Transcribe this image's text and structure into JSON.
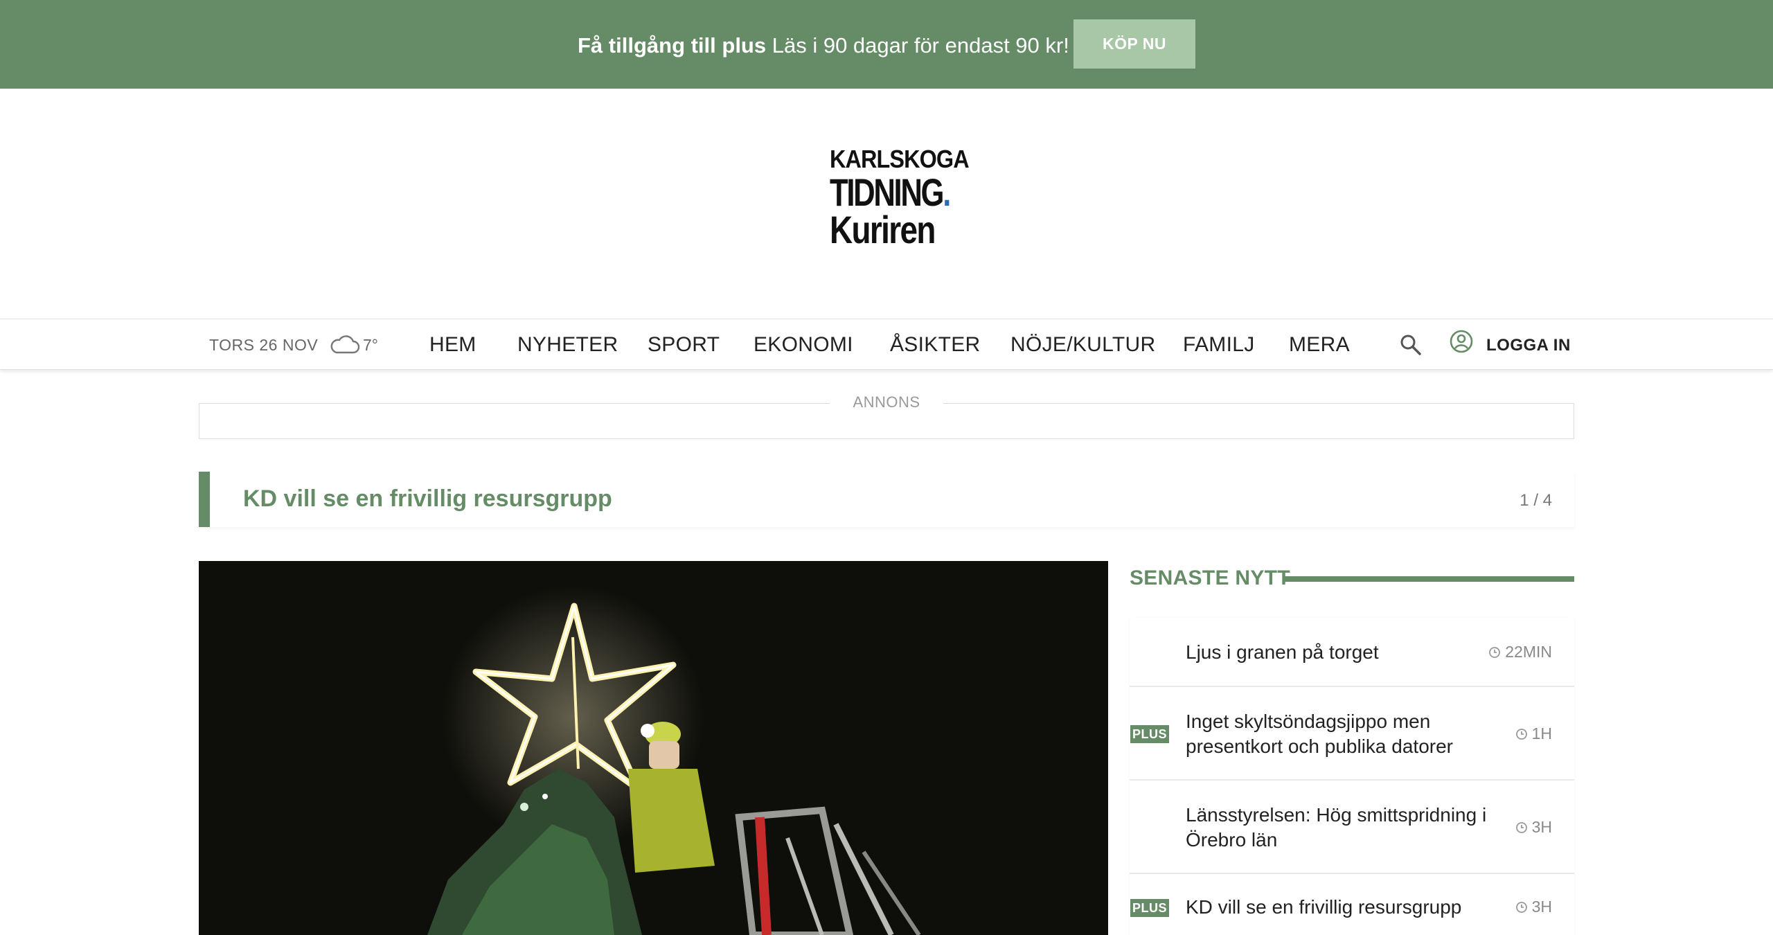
{
  "promo": {
    "bold": "Få tillgång till plus",
    "text": " Läs i 90 dagar för endast 90 kr!",
    "button": "KÖP NU"
  },
  "logo": {
    "line1": "KARLSKOGA",
    "line2": "TIDNING",
    "line2_dot": ".",
    "line3": "Kuriren"
  },
  "nav": {
    "date": "TORS 26 NOV",
    "weather_icon": "cloud-icon",
    "temperature": "7°",
    "items": [
      "HEM",
      "NYHETER",
      "SPORT",
      "EKONOMI",
      "ÅSIKTER",
      "NÖJE/KULTUR",
      "FAMILJ",
      "MERA"
    ],
    "login": "LOGGA IN"
  },
  "ad": {
    "label": "ANNONS"
  },
  "ticker": {
    "title": "KD vill se en frivillig resursgrupp",
    "count": "1 / 4"
  },
  "latest": {
    "title": "SENASTE NYTT",
    "items": [
      {
        "headline": "Ljus i granen på torget",
        "time": "22MIN",
        "plus": false
      },
      {
        "headline": "Inget skyltsöndagsjippo men presentkort och publika datorer",
        "time": "1H",
        "plus": true,
        "badge": "PLUS"
      },
      {
        "headline": "Länsstyrelsen: Hög smittspridning i Örebro län",
        "time": "3H",
        "plus": false
      },
      {
        "headline": "KD vill se en frivillig resursgrupp",
        "time": "3H",
        "plus": true,
        "badge": "PLUS"
      }
    ]
  },
  "colors": {
    "brand_green": "#658c66",
    "button_green": "#a8c7a6",
    "logo_dot": "#2e6ab1"
  }
}
